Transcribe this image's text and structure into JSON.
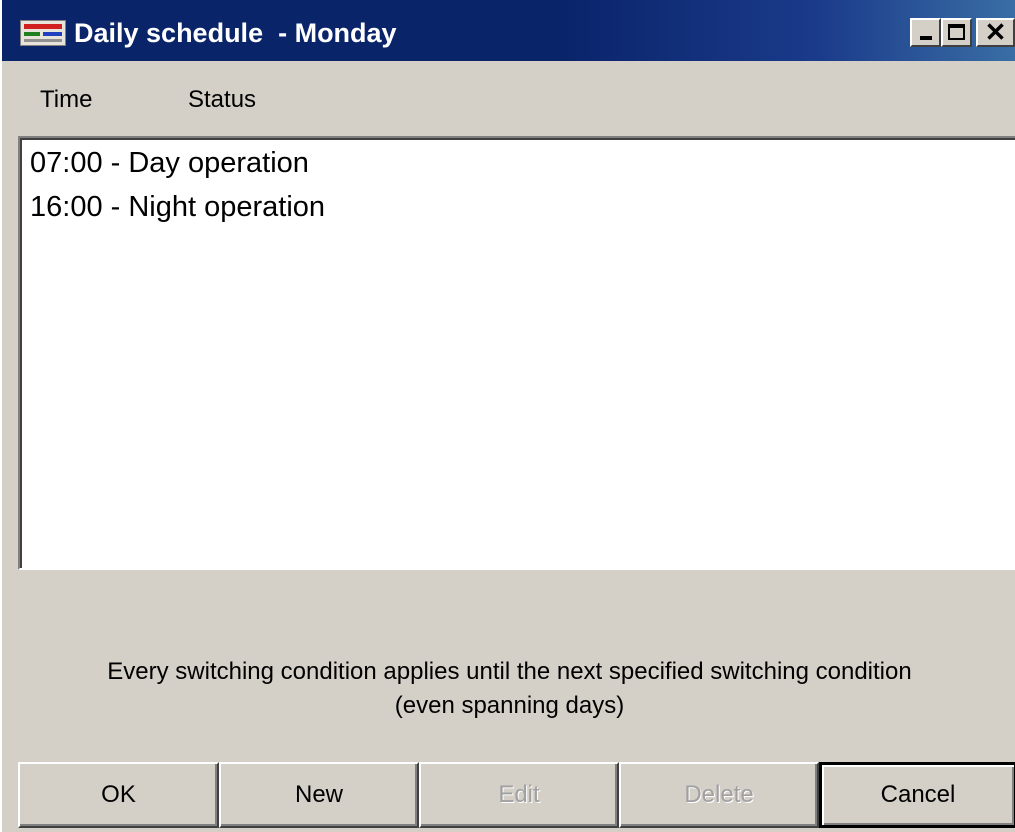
{
  "window": {
    "title": "Daily schedule  - Monday",
    "controls": {
      "minimize_icon": "minimize-icon",
      "maximize_icon": "maximize-icon",
      "close_label": "✕"
    }
  },
  "columns": {
    "time": "Time",
    "status": "Status"
  },
  "schedule": {
    "items": [
      {
        "label": "07:00 - Day operation"
      },
      {
        "label": "16:00 - Night operation"
      }
    ]
  },
  "info": {
    "line1": "Every switching condition applies until the next specified switching condition",
    "line2": "(even spanning days)"
  },
  "buttons": {
    "ok": "OK",
    "new": "New",
    "edit": "Edit",
    "delete": "Delete",
    "cancel": "Cancel"
  },
  "colors": {
    "title_bar": "#0a246a",
    "window_face": "#d4d0c8",
    "list_background": "#ffffff",
    "disabled_text": "#a0a0a0"
  }
}
